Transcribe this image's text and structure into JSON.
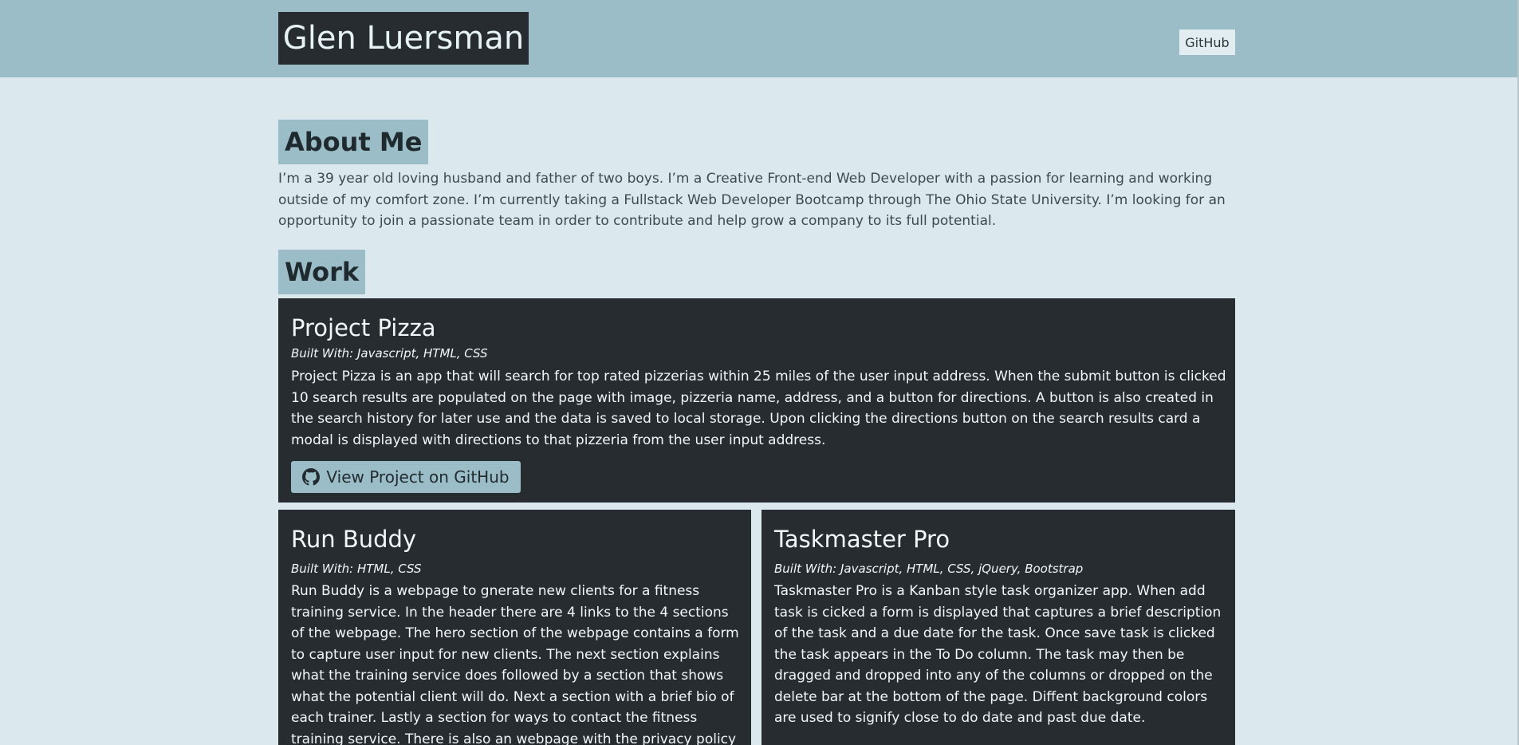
{
  "header": {
    "title": "Glen Luersman",
    "nav_link": "GitHub"
  },
  "about": {
    "heading": "About Me",
    "text": "I’m a 39 year old loving husband and father of two boys. I’m a Creative Front-end Web Developer with a passion for learning and working outside of my comfort zone. I’m currently taking a Fullstack Web Developer Bootcamp through The Ohio State University. I’m looking for an opportunity to join a passionate team in order to contribute and help grow a company to its full potential."
  },
  "work": {
    "heading": "Work",
    "projects": [
      {
        "title": "Project Pizza",
        "built_with": "Built With: Javascript, HTML, CSS",
        "description": "Project Pizza is an app that will search for top rated pizzerias within 25 miles of the user input address. When the submit button is clicked 10 search results are populated on the page with image, pizzeria name, address, and a button for directions. A button is also created in the search history for later use and the data is saved to local storage. Upon clicking the directions button on the search results card a modal is displayed with directions to that pizzeria from the user input address.",
        "button_label": "View Project on GitHub",
        "button_icon": "github-icon"
      },
      {
        "title": "Run Buddy",
        "built_with": "Built With: HTML, CSS",
        "description": "Run Buddy is a webpage to gnerate new clients for a fitness training service. In the header there are 4 links to the 4 sections of the webpage. The hero section of the webpage contains a form to capture user input for new clients. The next section explains what the training service does followed by a section that shows what the potential client will do. Next a section with a brief bio of each trainer. Lastly a section for ways to contact the fitness training service. There is also an webpage with the privacy policy that can be accessed via a"
      },
      {
        "title": "Taskmaster Pro",
        "built_with": "Built With: Javascript, HTML, CSS, jQuery, Bootstrap",
        "description": "Taskmaster Pro is a Kanban style task organizer app. When add task is cicked a form is displayed that captures a brief description of the task and a due date for the task. Once save task is clicked the task appears in the To Do column. The task may then be dragged and dropped into any of the columns or dropped on the delete bar at the bottom of the page. Diffent background colors are used to signify close to do date and past due date."
      }
    ]
  },
  "colors": {
    "header_bg": "#9bbdc7",
    "page_bg": "#dbe9ee",
    "card_bg": "#262c30"
  }
}
